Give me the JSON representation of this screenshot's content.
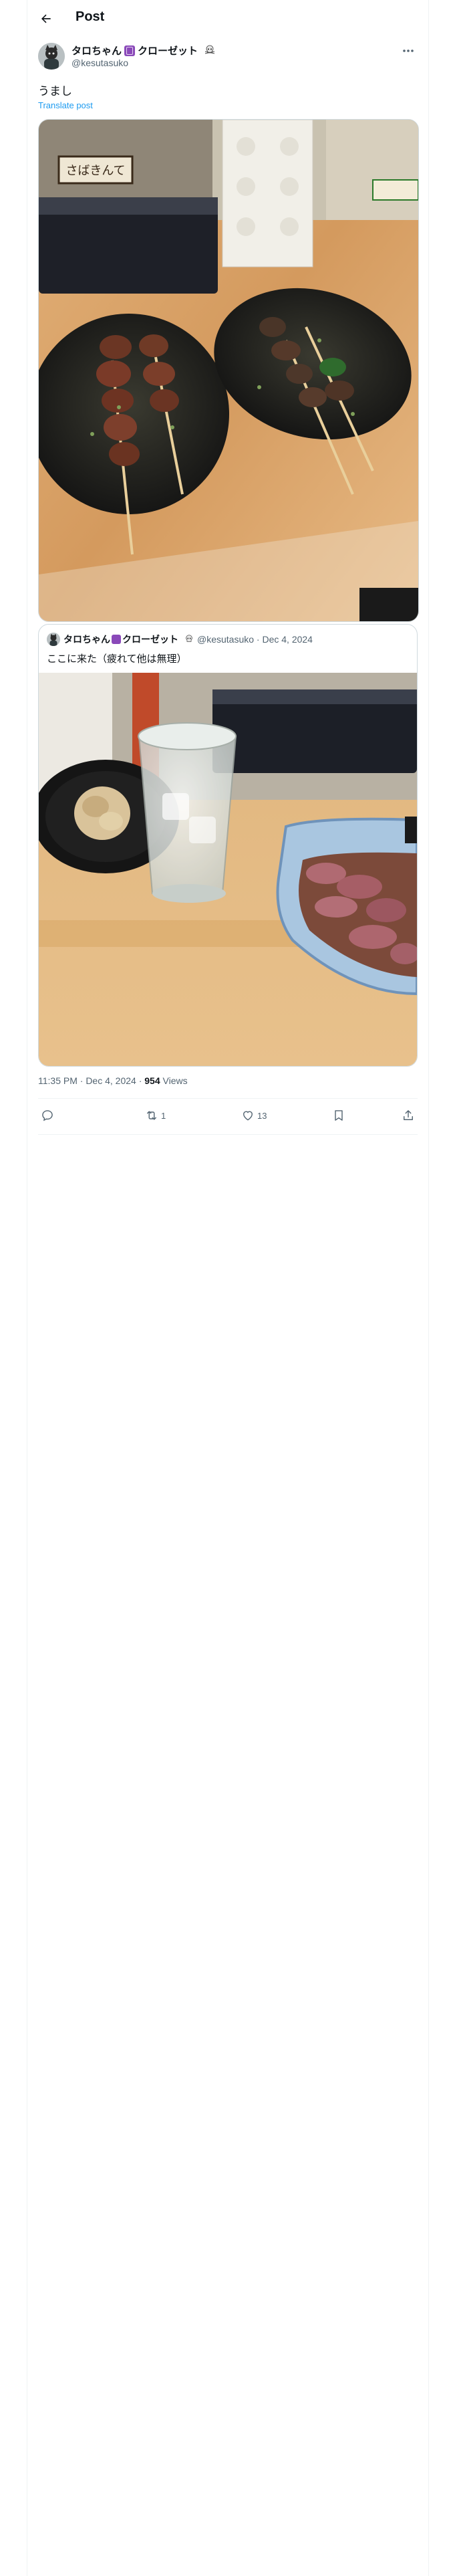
{
  "header": {
    "title": "Post",
    "back_icon": "arrow-left-icon"
  },
  "post": {
    "author_name": "タロちゃん",
    "author_name_suffix": "クローゼット",
    "author_handle": "@kesutasuko",
    "text": "うまし",
    "translate_label": "Translate post",
    "more_icon": "more-horizontal-icon",
    "timestamp": "11:35 PM · Dec 4, 2024 · ",
    "views_count": "954",
    "views_label": " Views",
    "image_description": "Two black plates of grilled yakitori skewers on a wooden counter"
  },
  "quote": {
    "author_name": "タロちゃん",
    "author_name_suffix": "クローゼット",
    "meta": "@kesutasuko · Dec 4, 2024",
    "text": "ここに来た（疲れて他は無理）",
    "image_description": "Glass of shochu on ice, small bowl of grated daikon and a dish of simmered liver on a wooden counter"
  },
  "actions": {
    "reply_count": "",
    "repost_count": "1",
    "like_count": "13",
    "bookmark_count": "",
    "share_count": ""
  },
  "colors": {
    "accent": "#1d9bf0",
    "text": "#0f1419",
    "muted": "#536471",
    "border": "#cfd9de"
  }
}
